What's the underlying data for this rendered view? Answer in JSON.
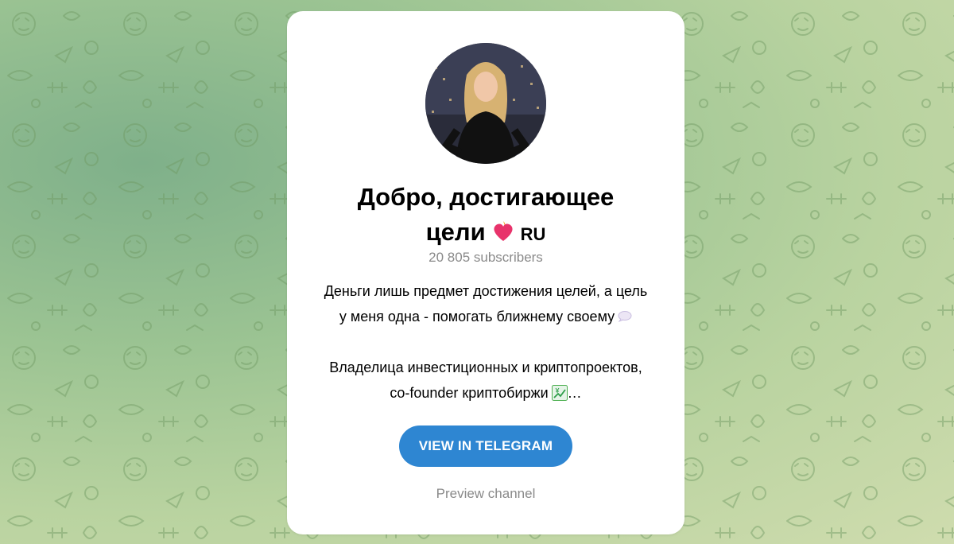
{
  "channel": {
    "title_line1": "Добро, достигающее",
    "title_line2": "цели",
    "title_suffix": "RU",
    "subscribers": "20 805 subscribers",
    "description_line1": "Деньги лишь предмет достижения целей, а цель",
    "description_line2": "у меня одна - помогать ближнему своему",
    "description_line3": "Владелица инвестиционных и криптопроектов,",
    "description_line4": "co-founder криптобиржи",
    "description_ellipsis": "…"
  },
  "actions": {
    "view_button": "VIEW IN TELEGRAM",
    "preview_link": "Preview channel"
  },
  "icons": {
    "heart": "heart-on-fire-icon",
    "chat": "speech-bubble-icon",
    "chart": "chart-increasing-yen-icon"
  },
  "colors": {
    "button": "#2e86d2",
    "muted": "#8a8a8a",
    "background": "#9cc493"
  }
}
